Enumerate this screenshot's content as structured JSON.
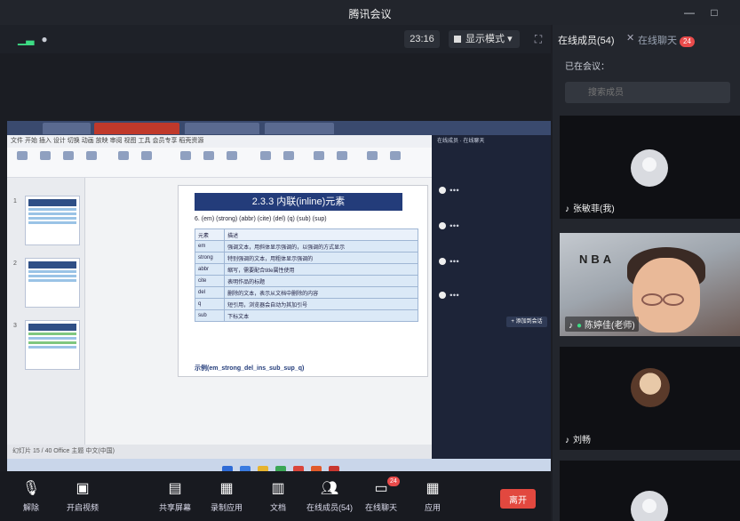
{
  "window": {
    "title": "腾讯会议"
  },
  "toolbar": {
    "clock": "23:16",
    "view_mode": "显示模式"
  },
  "right_panel": {
    "tab_members": "在线成员(54)",
    "tab_chat": "在线聊天",
    "chat_badge": "24",
    "sub_heading": "已在会议：",
    "search_placeholder": "搜索成员"
  },
  "participants": [
    {
      "name": "张敏菲(我)"
    },
    {
      "name": "陈婷佳(老师)"
    },
    {
      "name": "刘畅"
    },
    {
      "name": ""
    }
  ],
  "shared_screen": {
    "slide_title": "2.3.3 内联(inline)元素",
    "slide_subtitle": "6. (em) (strong) (abbr) (cite) (del) (q) (sub) (sup)",
    "table_head": [
      "元素",
      "描述"
    ],
    "table_rows": [
      [
        "em",
        "强调文本，用斜体显示强调的，以强调的方式显示"
      ],
      [
        "strong",
        "特别强调的文本，用粗体显示强调的"
      ],
      [
        "abbr",
        "缩写，需要配合title属性使用"
      ],
      [
        "cite",
        "表明作品的标题"
      ],
      [
        "del",
        "删除的文本，表示从文档中删除的内容"
      ],
      [
        "q",
        "短引用，浏览器会自动为其加引号"
      ],
      [
        "sub",
        "下标文本"
      ]
    ],
    "slide_footer": "示例(em_strong_del_ins_sub_sup_q)",
    "doc_status": "幻灯片 15 / 40   Office 主题   中文(中国)",
    "inner_chat_button": "+ 添加到会话"
  },
  "bottom_bar": {
    "mute": "解除",
    "video": "开启视频",
    "share": "共享屏幕",
    "record": "录制应用",
    "docs": "文档",
    "members": "在线成员(54)",
    "chat": "在线聊天",
    "apps": "应用",
    "leave": "离开",
    "chat_badge": "24"
  }
}
